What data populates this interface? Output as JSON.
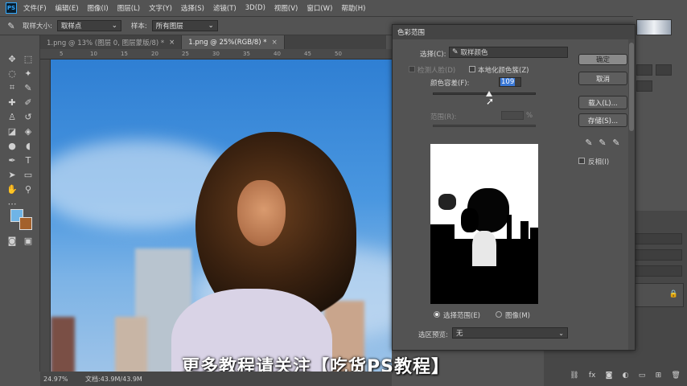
{
  "menubar": {
    "app_icon": "PS",
    "items": [
      "文件(F)",
      "编辑(E)",
      "图像(I)",
      "图层(L)",
      "文字(Y)",
      "选择(S)",
      "滤镜(T)",
      "3D(D)",
      "视图(V)",
      "窗口(W)",
      "帮助(H)"
    ]
  },
  "options": {
    "tool_icon": "eyedropper-icon",
    "sample_size_label": "取样大小:",
    "sample_size_value": "取样点",
    "sample_label": "样本:",
    "sample_value": "所有图层"
  },
  "tabs": [
    {
      "label": "1.png @ 13% (图层 0, 图层蒙版/8) *",
      "close": "×"
    },
    {
      "label": "1.png @ 25%(RGB/8) *",
      "close": "×"
    }
  ],
  "ruler": {
    "ticks": [
      "5",
      "10",
      "15",
      "20",
      "25",
      "30",
      "35",
      "40",
      "45",
      "50"
    ]
  },
  "status": {
    "zoom": "24.97%",
    "doc": "文档:43.9M/43.9M"
  },
  "subtitle": "更多教程请关注【吃货PS教程】",
  "dialog": {
    "title": "色彩范围",
    "select_label": "选择(C):",
    "select_value": "取样颜色",
    "detect_faces": "检测人脸(D)",
    "localized": "本地化颜色簇(Z)",
    "fuzziness_label": "颜色容差(F):",
    "fuzziness_value": "109",
    "fuzziness_fraction": 0.55,
    "range_label": "范围(R):",
    "range_unit": "%",
    "buttons": {
      "ok": "确定",
      "cancel": "取消",
      "load": "载入(L)...",
      "save": "存储(S)..."
    },
    "invert": "反相(I)",
    "radio_selection": "选择范围(E)",
    "radio_image": "图像(M)",
    "preview_label": "选区预览:",
    "preview_value": "无"
  }
}
